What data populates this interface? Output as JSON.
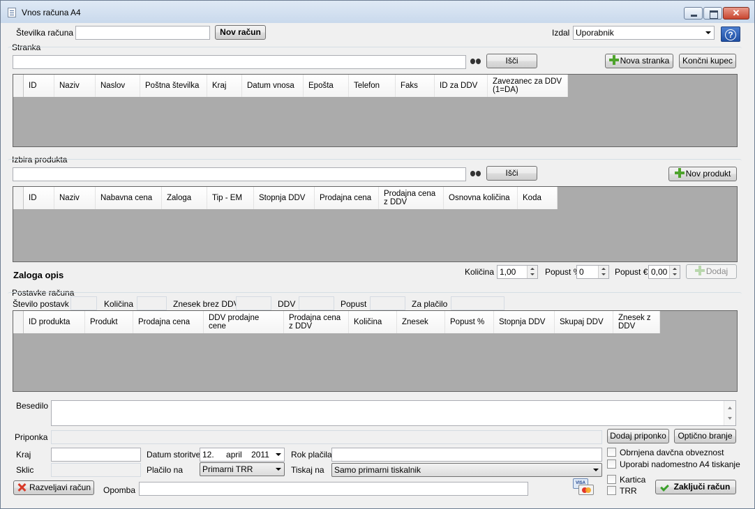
{
  "window": {
    "title": "Vnos računa A4"
  },
  "header": {
    "invoice_number_label": "Številka računa",
    "invoice_number_value": "",
    "new_invoice_button": "Nov račun",
    "issued_by_label": "Izdal",
    "issued_by_value": "Uporabnik"
  },
  "customer": {
    "section_label": "Stranka",
    "search_value": "",
    "search_button": "Išči",
    "new_customer_button": "Nova stranka",
    "end_customer_button": "Končni kupec",
    "columns": [
      "ID",
      "Naziv",
      "Naslov",
      "Poštna številka",
      "Kraj",
      "Datum vnosa",
      "Epošta",
      "Telefon",
      "Faks",
      "ID za DDV",
      "Zavezanec za DDV (1=DA)"
    ]
  },
  "product": {
    "section_label": "Izbira produkta",
    "search_value": "",
    "search_button": "Išči",
    "new_product_button": "Nov produkt",
    "columns": [
      "ID",
      "Naziv",
      "Nabavna cena",
      "Zaloga",
      "Tip - EM",
      "Stopnja DDV",
      "Prodajna cena",
      "Prodajna cena z DDV",
      "Osnovna količina",
      "Koda"
    ],
    "stock_description": "Zaloga opis",
    "quantity_label": "Količina",
    "quantity_value": "1,00",
    "discount_pct_label": "Popust %",
    "discount_pct_value": "0",
    "discount_eur_label": "Popust €",
    "discount_eur_value": "0,00",
    "add_button": "Dodaj"
  },
  "items": {
    "section_label": "Postavke računa",
    "count_label": "Število postavk",
    "quantity_label": "Količina",
    "amount_no_vat_label": "Znesek brez DDV",
    "vat_label": "DDV",
    "discount_label": "Popust",
    "to_pay_label": "Za plačilo",
    "columns": [
      "ID produkta",
      "Produkt",
      "Prodajna cena",
      "DDV prodajne cene",
      "Prodajna cena z DDV",
      "Količina",
      "Znesek",
      "Popust %",
      "Stopnja DDV",
      "Skupaj DDV",
      "Znesek z DDV"
    ]
  },
  "footer": {
    "text_label": "Besedilo",
    "attachment_label": "Priponka",
    "add_attachment_button": "Dodaj priponko",
    "optical_read_button": "Optično branje",
    "place_label": "Kraj",
    "service_date_label": "Datum storitve",
    "date_day": "12.",
    "date_month": "april",
    "date_year": "2011",
    "due_label": "Rok plačila",
    "reverse_charge_label": "Obrnjena davčna obveznost",
    "reference_label": "Sklic",
    "payment_to_label": "Plačilo na",
    "payment_to_value": "Primarni TRR",
    "print_to_label": "Tiskaj na",
    "print_to_value": "Samo primarni tiskalnik",
    "a4_alt_label": "Uporabi nadomestno A4 tiskanje",
    "cancel_button": "Razveljavi račun",
    "note_label": "Opomba",
    "card_label": "Kartica",
    "trr_label": "TRR",
    "close_invoice_button": "Zaključi račun"
  }
}
